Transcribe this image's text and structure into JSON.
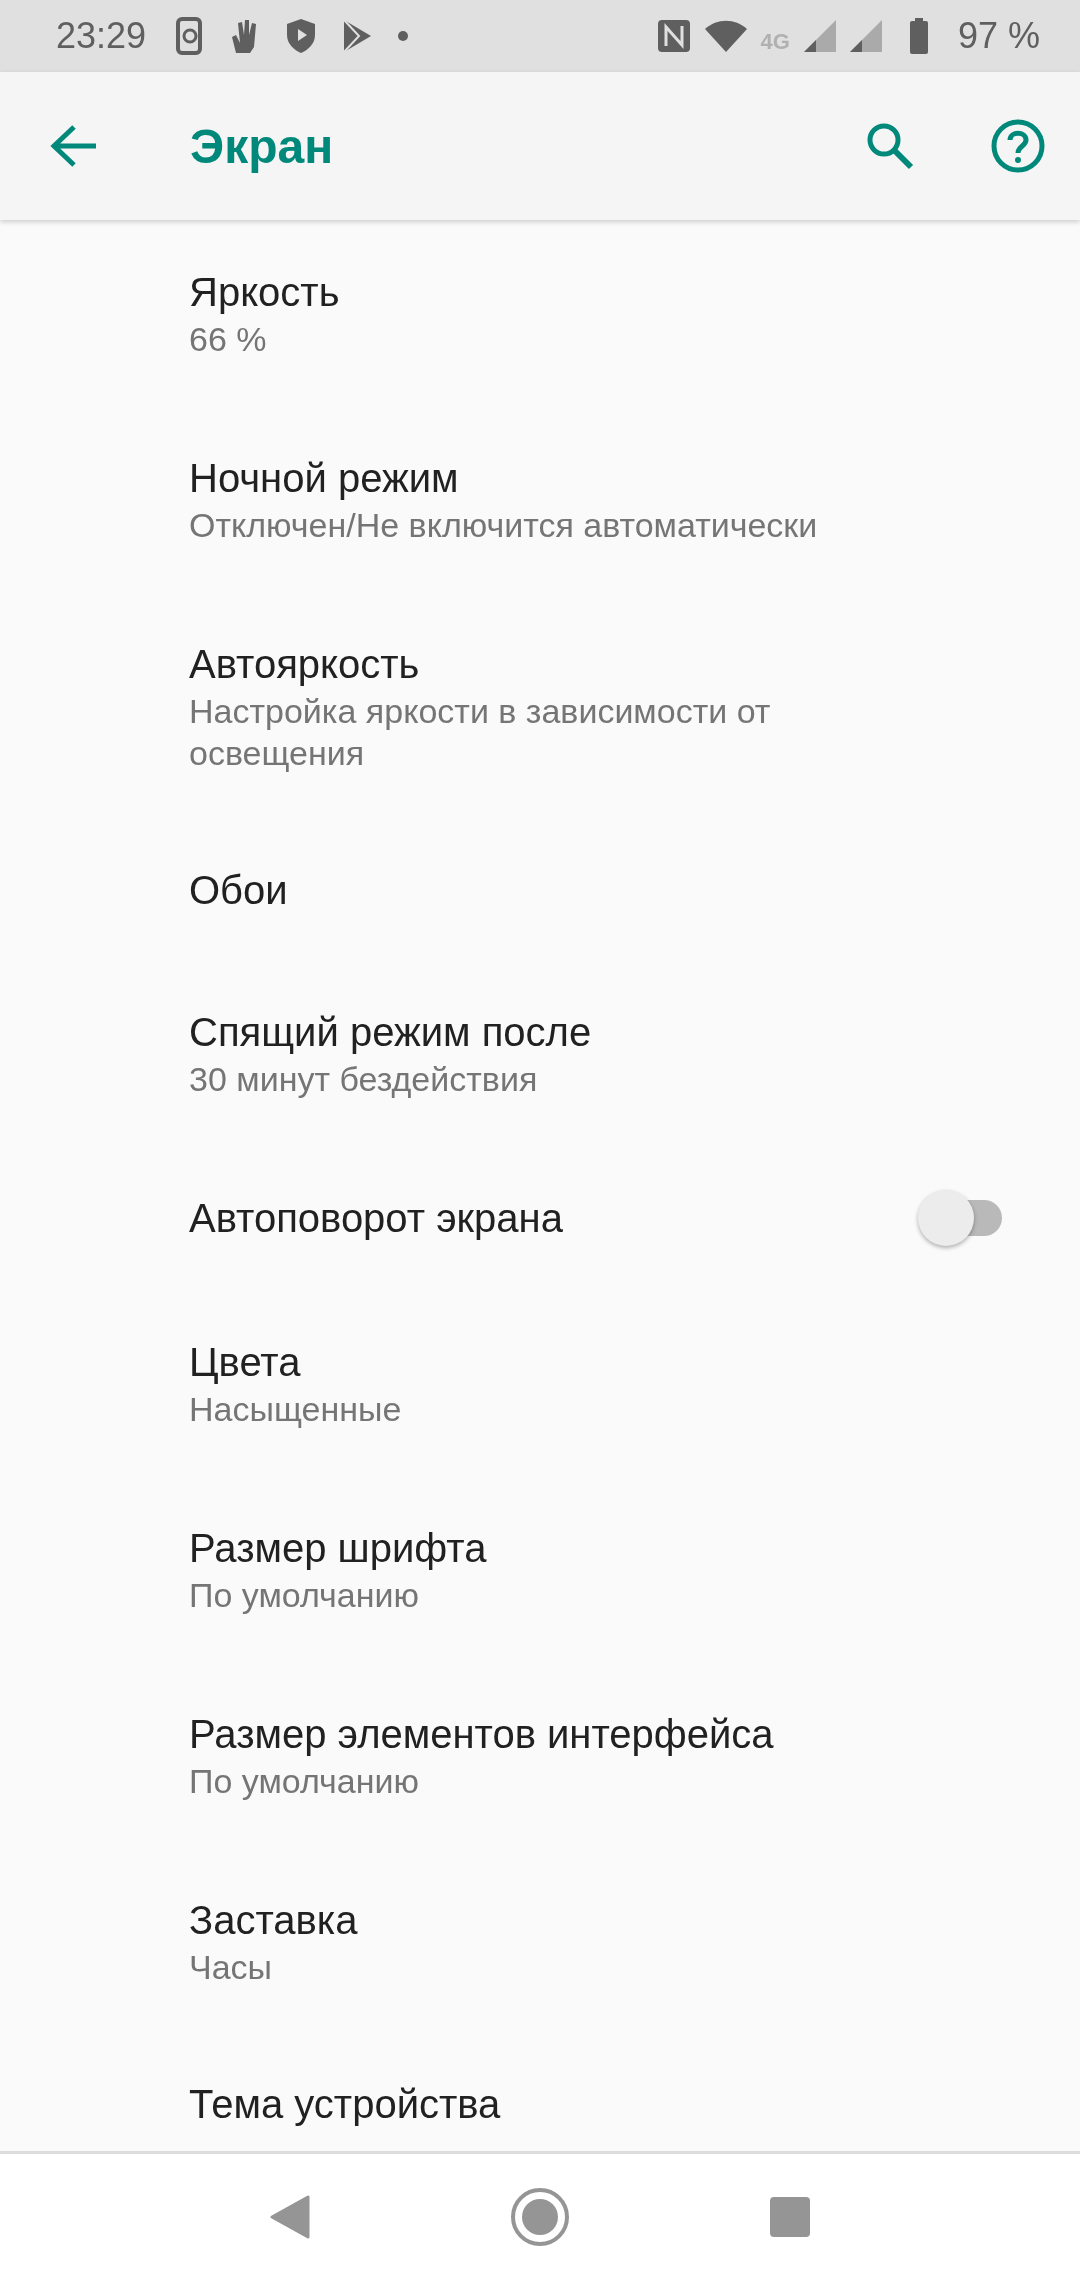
{
  "status_bar": {
    "time": "23:29",
    "network": "4G",
    "battery": "97 %"
  },
  "toolbar": {
    "title": "Экран"
  },
  "settings": [
    {
      "kind": "text",
      "title": "Яркость",
      "summary": "66 %"
    },
    {
      "kind": "text",
      "title": "Ночной режим",
      "summary": "Отключен/Не включится автоматически"
    },
    {
      "kind": "text",
      "title": "Автояркость",
      "summary": "Настройка яркости в зависимости от освещения"
    },
    {
      "kind": "text",
      "title": "Обои"
    },
    {
      "kind": "text",
      "title": "Спящий режим после",
      "summary": "30 минут бездействия"
    },
    {
      "kind": "switch",
      "title": "Автоповорот экрана",
      "on": false
    },
    {
      "kind": "text",
      "title": "Цвета",
      "summary": "Насыщенные"
    },
    {
      "kind": "text",
      "title": "Размер шрифта",
      "summary": "По умолчанию"
    },
    {
      "kind": "text",
      "title": "Размер элементов интерфейса",
      "summary": "По умолчанию"
    },
    {
      "kind": "text",
      "title": "Заставка",
      "summary": "Часы"
    },
    {
      "kind": "text",
      "title": "Тема устройства"
    }
  ]
}
